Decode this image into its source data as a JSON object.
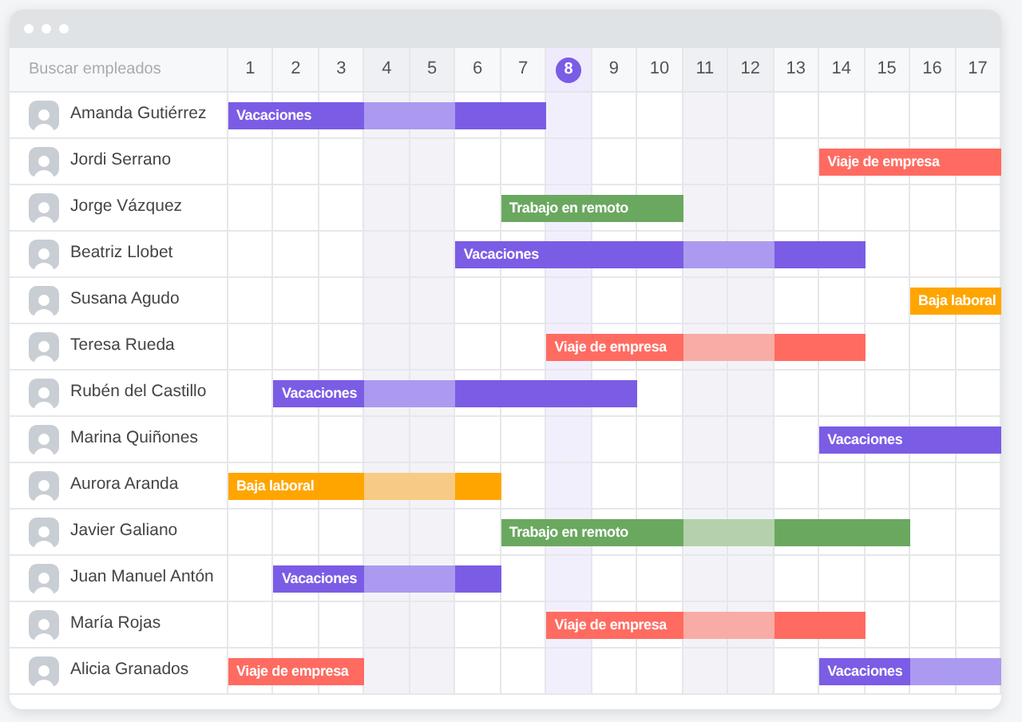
{
  "search": {
    "placeholder": "Buscar empleados"
  },
  "days": [
    {
      "label": "1",
      "weekend": false,
      "today": false
    },
    {
      "label": "2",
      "weekend": false,
      "today": false
    },
    {
      "label": "3",
      "weekend": false,
      "today": false
    },
    {
      "label": "4",
      "weekend": true,
      "today": false
    },
    {
      "label": "5",
      "weekend": true,
      "today": false
    },
    {
      "label": "6",
      "weekend": false,
      "today": false
    },
    {
      "label": "7",
      "weekend": false,
      "today": false
    },
    {
      "label": "8",
      "weekend": false,
      "today": true
    },
    {
      "label": "9",
      "weekend": false,
      "today": false
    },
    {
      "label": "10",
      "weekend": false,
      "today": false
    },
    {
      "label": "11",
      "weekend": true,
      "today": false
    },
    {
      "label": "12",
      "weekend": true,
      "today": false
    },
    {
      "label": "13",
      "weekend": false,
      "today": false
    },
    {
      "label": "14",
      "weekend": false,
      "today": false
    },
    {
      "label": "15",
      "weekend": false,
      "today": false
    },
    {
      "label": "16",
      "weekend": false,
      "today": false
    },
    {
      "label": "17",
      "weekend": false,
      "today": false
    }
  ],
  "employees": [
    {
      "name": "Amanda Gutiérrez",
      "cells": [
        {
          "kind": "vacation",
          "faded": false,
          "label": "Vacaciones"
        },
        {
          "kind": "vacation",
          "faded": false
        },
        {
          "kind": "vacation",
          "faded": false
        },
        {
          "kind": "vacation",
          "faded": true
        },
        {
          "kind": "vacation",
          "faded": true
        },
        {
          "kind": "vacation",
          "faded": false
        },
        {
          "kind": "vacation",
          "faded": false
        },
        {
          "kind": "none"
        },
        {
          "kind": "none"
        },
        {
          "kind": "none"
        },
        {
          "kind": "none"
        },
        {
          "kind": "none"
        },
        {
          "kind": "none"
        },
        {
          "kind": "none"
        },
        {
          "kind": "none"
        },
        {
          "kind": "none"
        },
        {
          "kind": "none"
        }
      ]
    },
    {
      "name": "Jordi Serrano",
      "cells": [
        {
          "kind": "none"
        },
        {
          "kind": "none"
        },
        {
          "kind": "none"
        },
        {
          "kind": "none"
        },
        {
          "kind": "none"
        },
        {
          "kind": "none"
        },
        {
          "kind": "none"
        },
        {
          "kind": "none"
        },
        {
          "kind": "none"
        },
        {
          "kind": "none"
        },
        {
          "kind": "none"
        },
        {
          "kind": "none"
        },
        {
          "kind": "none"
        },
        {
          "kind": "trip",
          "faded": false,
          "label": "Viaje de empresa"
        },
        {
          "kind": "trip",
          "faded": false
        },
        {
          "kind": "trip",
          "faded": false
        },
        {
          "kind": "trip",
          "faded": false
        }
      ]
    },
    {
      "name": "Jorge Vázquez",
      "cells": [
        {
          "kind": "none"
        },
        {
          "kind": "none"
        },
        {
          "kind": "none"
        },
        {
          "kind": "none"
        },
        {
          "kind": "none"
        },
        {
          "kind": "none"
        },
        {
          "kind": "remote",
          "faded": false,
          "label": "Trabajo en remoto"
        },
        {
          "kind": "remote",
          "faded": false
        },
        {
          "kind": "remote",
          "faded": false
        },
        {
          "kind": "remote",
          "faded": false
        },
        {
          "kind": "none"
        },
        {
          "kind": "none"
        },
        {
          "kind": "none"
        },
        {
          "kind": "none"
        },
        {
          "kind": "none"
        },
        {
          "kind": "none"
        },
        {
          "kind": "none"
        }
      ]
    },
    {
      "name": "Beatriz Llobet",
      "cells": [
        {
          "kind": "none"
        },
        {
          "kind": "none"
        },
        {
          "kind": "none"
        },
        {
          "kind": "none"
        },
        {
          "kind": "none"
        },
        {
          "kind": "vacation",
          "faded": false,
          "label": "Vacaciones"
        },
        {
          "kind": "vacation",
          "faded": false
        },
        {
          "kind": "vacation",
          "faded": false
        },
        {
          "kind": "vacation",
          "faded": false
        },
        {
          "kind": "vacation",
          "faded": false
        },
        {
          "kind": "vacation",
          "faded": true
        },
        {
          "kind": "vacation",
          "faded": true
        },
        {
          "kind": "vacation",
          "faded": false
        },
        {
          "kind": "vacation",
          "faded": false
        },
        {
          "kind": "none"
        },
        {
          "kind": "none"
        },
        {
          "kind": "none"
        }
      ]
    },
    {
      "name": "Susana Agudo",
      "cells": [
        {
          "kind": "none"
        },
        {
          "kind": "none"
        },
        {
          "kind": "none"
        },
        {
          "kind": "none"
        },
        {
          "kind": "none"
        },
        {
          "kind": "none"
        },
        {
          "kind": "none"
        },
        {
          "kind": "none"
        },
        {
          "kind": "none"
        },
        {
          "kind": "none"
        },
        {
          "kind": "none"
        },
        {
          "kind": "none"
        },
        {
          "kind": "none"
        },
        {
          "kind": "none"
        },
        {
          "kind": "none"
        },
        {
          "kind": "sick",
          "faded": false,
          "label": "Baja laboral"
        },
        {
          "kind": "sick",
          "faded": false
        }
      ]
    },
    {
      "name": "Teresa Rueda",
      "cells": [
        {
          "kind": "none"
        },
        {
          "kind": "none"
        },
        {
          "kind": "none"
        },
        {
          "kind": "none"
        },
        {
          "kind": "none"
        },
        {
          "kind": "none"
        },
        {
          "kind": "none"
        },
        {
          "kind": "trip",
          "faded": false,
          "label": "Viaje de empresa"
        },
        {
          "kind": "trip",
          "faded": false
        },
        {
          "kind": "trip",
          "faded": false
        },
        {
          "kind": "trip",
          "faded": true
        },
        {
          "kind": "trip",
          "faded": true
        },
        {
          "kind": "trip",
          "faded": false
        },
        {
          "kind": "trip",
          "faded": false
        },
        {
          "kind": "none"
        },
        {
          "kind": "none"
        },
        {
          "kind": "none"
        }
      ]
    },
    {
      "name": "Rubén del Castillo",
      "cells": [
        {
          "kind": "none"
        },
        {
          "kind": "vacation",
          "faded": false,
          "label": "Vacaciones"
        },
        {
          "kind": "vacation",
          "faded": false
        },
        {
          "kind": "vacation",
          "faded": true
        },
        {
          "kind": "vacation",
          "faded": true
        },
        {
          "kind": "vacation",
          "faded": false
        },
        {
          "kind": "vacation",
          "faded": false
        },
        {
          "kind": "vacation",
          "faded": false
        },
        {
          "kind": "vacation",
          "faded": false
        },
        {
          "kind": "none"
        },
        {
          "kind": "none"
        },
        {
          "kind": "none"
        },
        {
          "kind": "none"
        },
        {
          "kind": "none"
        },
        {
          "kind": "none"
        },
        {
          "kind": "none"
        },
        {
          "kind": "none"
        }
      ]
    },
    {
      "name": "Marina Quiñones",
      "cells": [
        {
          "kind": "none"
        },
        {
          "kind": "none"
        },
        {
          "kind": "none"
        },
        {
          "kind": "none"
        },
        {
          "kind": "none"
        },
        {
          "kind": "none"
        },
        {
          "kind": "none"
        },
        {
          "kind": "none"
        },
        {
          "kind": "none"
        },
        {
          "kind": "none"
        },
        {
          "kind": "none"
        },
        {
          "kind": "none"
        },
        {
          "kind": "none"
        },
        {
          "kind": "vacation",
          "faded": false,
          "label": "Vacaciones"
        },
        {
          "kind": "vacation",
          "faded": false
        },
        {
          "kind": "vacation",
          "faded": false
        },
        {
          "kind": "vacation",
          "faded": false
        }
      ]
    },
    {
      "name": "Aurora Aranda",
      "cells": [
        {
          "kind": "sick",
          "faded": false,
          "label": "Baja laboral"
        },
        {
          "kind": "sick",
          "faded": false
        },
        {
          "kind": "sick",
          "faded": false
        },
        {
          "kind": "sick",
          "faded": true
        },
        {
          "kind": "sick",
          "faded": true
        },
        {
          "kind": "sick",
          "faded": false
        },
        {
          "kind": "none"
        },
        {
          "kind": "none"
        },
        {
          "kind": "none"
        },
        {
          "kind": "none"
        },
        {
          "kind": "none"
        },
        {
          "kind": "none"
        },
        {
          "kind": "none"
        },
        {
          "kind": "none"
        },
        {
          "kind": "none"
        },
        {
          "kind": "none"
        },
        {
          "kind": "none"
        }
      ]
    },
    {
      "name": "Javier Galiano",
      "cells": [
        {
          "kind": "none"
        },
        {
          "kind": "none"
        },
        {
          "kind": "none"
        },
        {
          "kind": "none"
        },
        {
          "kind": "none"
        },
        {
          "kind": "none"
        },
        {
          "kind": "remote",
          "faded": false,
          "label": "Trabajo en remoto"
        },
        {
          "kind": "remote",
          "faded": false
        },
        {
          "kind": "remote",
          "faded": false
        },
        {
          "kind": "remote",
          "faded": false
        },
        {
          "kind": "remote",
          "faded": true
        },
        {
          "kind": "remote",
          "faded": true
        },
        {
          "kind": "remote",
          "faded": false
        },
        {
          "kind": "remote",
          "faded": false
        },
        {
          "kind": "remote",
          "faded": false
        },
        {
          "kind": "none"
        },
        {
          "kind": "none"
        }
      ]
    },
    {
      "name": "Juan Manuel Antón",
      "cells": [
        {
          "kind": "none"
        },
        {
          "kind": "vacation",
          "faded": false,
          "label": "Vacaciones"
        },
        {
          "kind": "vacation",
          "faded": false
        },
        {
          "kind": "vacation",
          "faded": true
        },
        {
          "kind": "vacation",
          "faded": true
        },
        {
          "kind": "vacation",
          "faded": false
        },
        {
          "kind": "none"
        },
        {
          "kind": "none"
        },
        {
          "kind": "none"
        },
        {
          "kind": "none"
        },
        {
          "kind": "none"
        },
        {
          "kind": "none"
        },
        {
          "kind": "none"
        },
        {
          "kind": "none"
        },
        {
          "kind": "none"
        },
        {
          "kind": "none"
        },
        {
          "kind": "none"
        }
      ]
    },
    {
      "name": "María Rojas",
      "cells": [
        {
          "kind": "none"
        },
        {
          "kind": "none"
        },
        {
          "kind": "none"
        },
        {
          "kind": "none"
        },
        {
          "kind": "none"
        },
        {
          "kind": "none"
        },
        {
          "kind": "none"
        },
        {
          "kind": "trip",
          "faded": false,
          "label": "Viaje de empresa"
        },
        {
          "kind": "trip",
          "faded": false
        },
        {
          "kind": "trip",
          "faded": false
        },
        {
          "kind": "trip",
          "faded": true
        },
        {
          "kind": "trip",
          "faded": true
        },
        {
          "kind": "trip",
          "faded": false
        },
        {
          "kind": "trip",
          "faded": false
        },
        {
          "kind": "none"
        },
        {
          "kind": "none"
        },
        {
          "kind": "none"
        }
      ]
    },
    {
      "name": "Alicia Granados",
      "cells": [
        {
          "kind": "trip",
          "faded": false,
          "label": "Viaje de empresa"
        },
        {
          "kind": "trip",
          "faded": false
        },
        {
          "kind": "trip",
          "faded": false
        },
        {
          "kind": "none"
        },
        {
          "kind": "none"
        },
        {
          "kind": "none"
        },
        {
          "kind": "none"
        },
        {
          "kind": "none"
        },
        {
          "kind": "none"
        },
        {
          "kind": "none"
        },
        {
          "kind": "none"
        },
        {
          "kind": "none"
        },
        {
          "kind": "none"
        },
        {
          "kind": "vacation",
          "faded": false,
          "label": "Vacaciones"
        },
        {
          "kind": "vacation",
          "faded": false
        },
        {
          "kind": "vacation",
          "faded": true
        },
        {
          "kind": "vacation",
          "faded": true
        }
      ]
    }
  ]
}
